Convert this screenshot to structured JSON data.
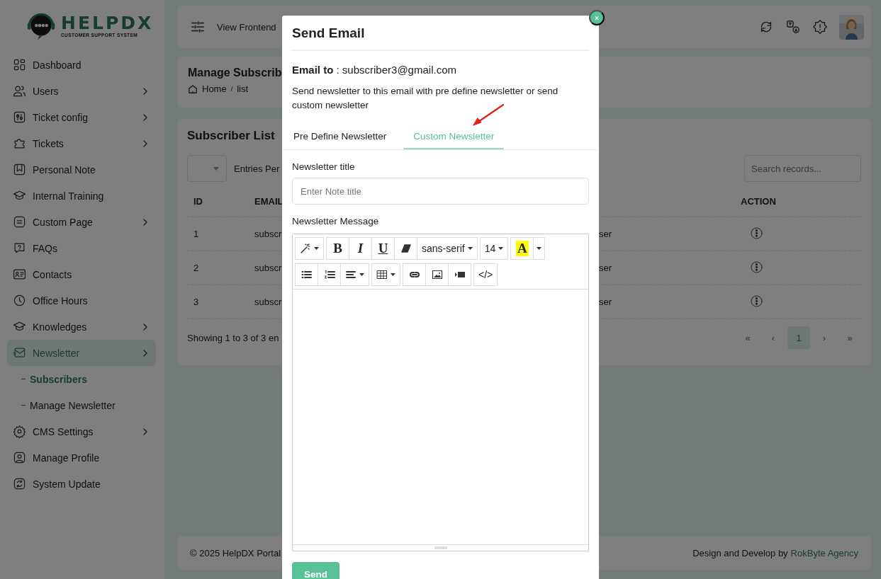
{
  "sidebar": {
    "logo": {
      "title": "HELPDX",
      "subtitle": "CUSTOMER SUPPORT SYSTEM"
    },
    "items": [
      {
        "label": "Dashboard",
        "has_submenu": false,
        "selected": false
      },
      {
        "label": "Users",
        "has_submenu": true,
        "selected": false
      },
      {
        "label": "Ticket config",
        "has_submenu": true,
        "selected": false
      },
      {
        "label": "Tickets",
        "has_submenu": true,
        "selected": false
      },
      {
        "label": "Personal Note",
        "has_submenu": false,
        "selected": false
      },
      {
        "label": "Internal Training",
        "has_submenu": false,
        "selected": false
      },
      {
        "label": "Custom Page",
        "has_submenu": true,
        "selected": false
      },
      {
        "label": "FAQs",
        "has_submenu": false,
        "selected": false
      },
      {
        "label": "Contacts",
        "has_submenu": false,
        "selected": false
      },
      {
        "label": "Office Hours",
        "has_submenu": false,
        "selected": false
      },
      {
        "label": "Knowledges",
        "has_submenu": true,
        "selected": false
      },
      {
        "label": "Newsletter",
        "has_submenu": true,
        "selected": true,
        "children": [
          {
            "label": "Subscribers",
            "selected": true
          },
          {
            "label": "Manage Newsletter",
            "selected": false
          }
        ]
      },
      {
        "label": "CMS Settings",
        "has_submenu": true,
        "selected": false
      },
      {
        "label": "Manage Profile",
        "has_submenu": false,
        "selected": false
      },
      {
        "label": "System Update",
        "has_submenu": false,
        "selected": false
      }
    ]
  },
  "topbar": {
    "link": "View Frontend"
  },
  "page_header": {
    "title": "Manage Subscrib",
    "breadcrumb": [
      "Home",
      "list"
    ],
    "separator": "/"
  },
  "subscriber_list": {
    "title": "Subscriber List",
    "entries_label": "Entries Per",
    "search": {
      "placeholder": "Search records..."
    },
    "columns": [
      "ID",
      "EMAIL",
      "",
      "ACTION"
    ],
    "rows": [
      {
        "id": "1",
        "email": "subscr",
        "column_3": "ser"
      },
      {
        "id": "2",
        "email": "subscr",
        "column_3": "ser"
      },
      {
        "id": "3",
        "email": "subscr",
        "column_3": "ser"
      }
    ],
    "summary": "Showing 1 to 3 of 3 en",
    "pagination": [
      {
        "label": "«",
        "selected": false
      },
      {
        "label": "‹",
        "selected": false
      },
      {
        "label": "1",
        "selected": true
      },
      {
        "label": "›",
        "selected": false
      },
      {
        "label": "»",
        "selected": false
      }
    ]
  },
  "footer": {
    "copyright": "© 2025 HelpDX Portal",
    "credit": "Design and Develop by",
    "credit_link": "RokByte Agency"
  },
  "modal": {
    "title": "Send Email",
    "email_line": "**Email to** : subscriber3@gmail.com",
    "description": "Send newsletter to this email with pre define newsletter or send custom newsletter",
    "tabs": [
      {
        "label": "Pre Define Newsletter",
        "selected": false
      },
      {
        "label": "Custom Newsletter",
        "selected": true
      }
    ],
    "title_field": {
      "label": "Newsletter title",
      "placeholder": "Enter Note title"
    },
    "message_label": "Newsletter Message",
    "toolbar": {
      "bold": "B",
      "italic": "I",
      "underline": "U",
      "font": "sans-serif",
      "size": "14",
      "text_color": "A",
      "code": "</>"
    },
    "send_button": "Send"
  }
}
